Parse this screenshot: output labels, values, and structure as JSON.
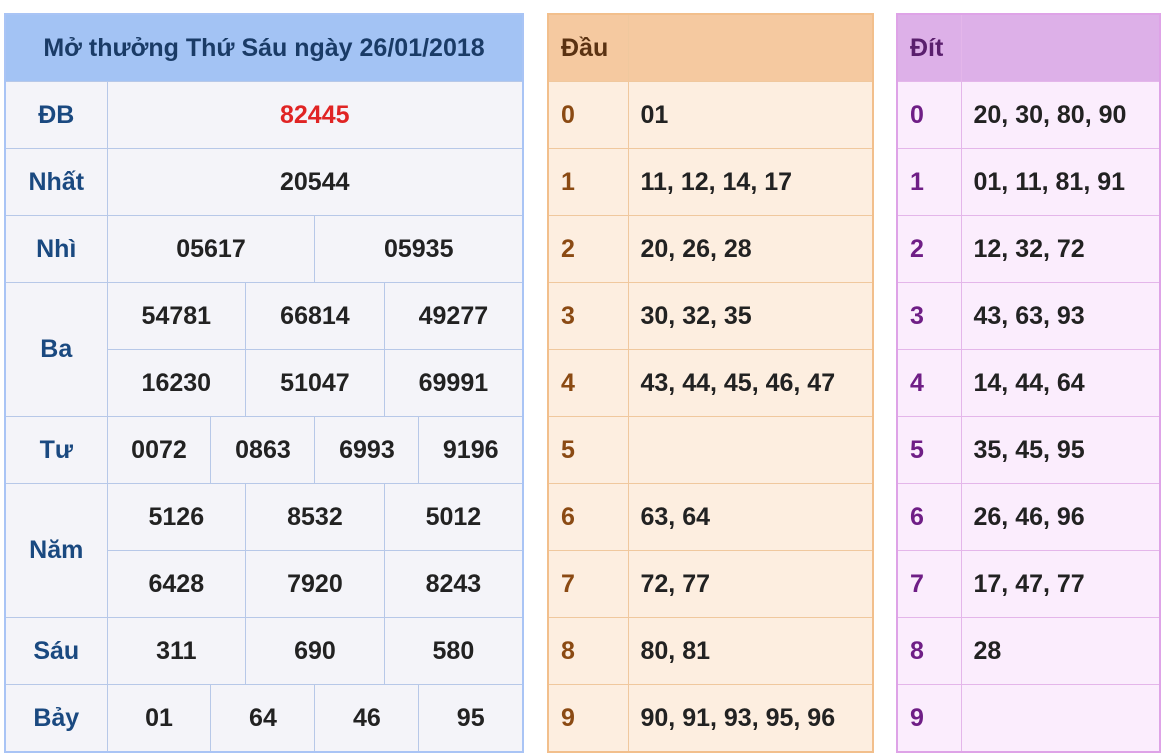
{
  "results": {
    "title": "Mở thưởng Thứ Sáu ngày 26/01/2018",
    "db": {
      "label": "ĐB",
      "values": [
        "82445"
      ]
    },
    "nhat": {
      "label": "Nhất",
      "values": [
        "20544"
      ]
    },
    "nhi": {
      "label": "Nhì",
      "values": [
        "05617",
        "05935"
      ]
    },
    "ba": {
      "label": "Ba",
      "values": [
        "54781",
        "66814",
        "49277",
        "16230",
        "51047",
        "69991"
      ]
    },
    "tu": {
      "label": "Tư",
      "values": [
        "0072",
        "0863",
        "6993",
        "9196"
      ]
    },
    "nam": {
      "label": "Năm",
      "values": [
        "5126",
        "8532",
        "5012",
        "6428",
        "7920",
        "8243"
      ]
    },
    "sau": {
      "label": "Sáu",
      "values": [
        "311",
        "690",
        "580"
      ]
    },
    "bay": {
      "label": "Bảy",
      "values": [
        "01",
        "64",
        "46",
        "95"
      ]
    }
  },
  "dau": {
    "header": "Đầu",
    "rows": [
      {
        "key": "0",
        "values": "01"
      },
      {
        "key": "1",
        "values": "11, 12, 14, 17"
      },
      {
        "key": "2",
        "values": "20, 26, 28"
      },
      {
        "key": "3",
        "values": "30, 32, 35"
      },
      {
        "key": "4",
        "values": "43, 44, 45, 46, 47"
      },
      {
        "key": "5",
        "values": ""
      },
      {
        "key": "6",
        "values": "63, 64"
      },
      {
        "key": "7",
        "values": "72, 77"
      },
      {
        "key": "8",
        "values": "80, 81"
      },
      {
        "key": "9",
        "values": "90, 91, 93, 95, 96"
      }
    ]
  },
  "dit": {
    "header": "Đít",
    "rows": [
      {
        "key": "0",
        "values": "20, 30, 80, 90"
      },
      {
        "key": "1",
        "values": "01, 11, 81, 91"
      },
      {
        "key": "2",
        "values": "12, 32, 72"
      },
      {
        "key": "3",
        "values": "43, 63, 93"
      },
      {
        "key": "4",
        "values": "14, 44, 64"
      },
      {
        "key": "5",
        "values": "35, 45, 95"
      },
      {
        "key": "6",
        "values": "26, 46, 96"
      },
      {
        "key": "7",
        "values": "17, 47, 77"
      },
      {
        "key": "8",
        "values": "28"
      },
      {
        "key": "9",
        "values": ""
      }
    ]
  }
}
